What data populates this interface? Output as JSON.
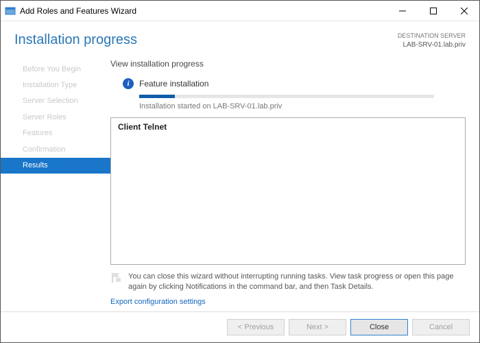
{
  "window": {
    "title": "Add Roles and Features Wizard"
  },
  "header": {
    "page_title": "Installation progress",
    "destination_label": "DESTINATION SERVER",
    "destination_name": "LAB-SRV-01.lab.priv"
  },
  "sidebar": {
    "items": [
      {
        "label": "Before You Begin",
        "active": false
      },
      {
        "label": "Installation Type",
        "active": false
      },
      {
        "label": "Server Selection",
        "active": false
      },
      {
        "label": "Server Roles",
        "active": false
      },
      {
        "label": "Features",
        "active": false
      },
      {
        "label": "Confirmation",
        "active": false
      },
      {
        "label": "Results",
        "active": true
      }
    ]
  },
  "main": {
    "section_label": "View installation progress",
    "feature_title": "Feature installation",
    "progress_message": "Installation started on LAB-SRV-01.lab.priv",
    "progress_percent": 12,
    "items": [
      "Client Telnet"
    ],
    "hint": "You can close this wizard without interrupting running tasks. View task progress or open this page again by clicking Notifications in the command bar, and then Task Details.",
    "export_link": "Export configuration settings"
  },
  "footer": {
    "previous": "< Previous",
    "next": "Next >",
    "close": "Close",
    "cancel": "Cancel"
  }
}
